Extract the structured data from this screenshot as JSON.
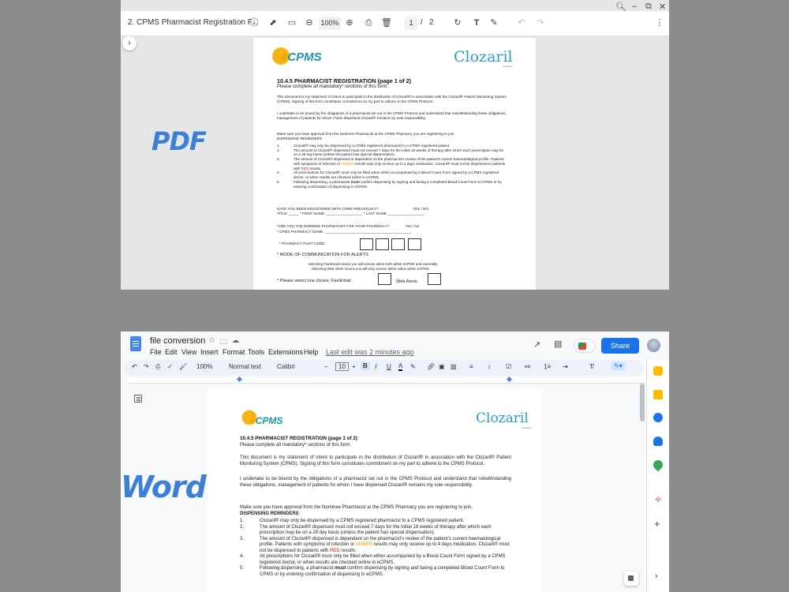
{
  "colors": {
    "accent": "#3d7fd7",
    "teal": "#1a9aa8",
    "amber": "#e8a000",
    "red": "#d01c1c",
    "docs_blue": "#1a73e8"
  },
  "badges": {
    "pdf": "PDF",
    "word": "Word"
  },
  "pdf_viewer": {
    "file_title": "2. CPMS Pharmacist Registration F...",
    "zoom": "100%",
    "page_current": "1",
    "page_total": "2",
    "icons": [
      "info-icon",
      "share-icon",
      "bookmark-icon",
      "zoom-out-icon",
      "zoom-in-icon",
      "print-icon",
      "delete-icon",
      "rotate-icon",
      "text-icon",
      "draw-icon",
      "undo-icon",
      "redo-icon",
      "more-icon",
      "window-zoom-icon",
      "minimize-icon",
      "restore-icon",
      "close-icon"
    ]
  },
  "document": {
    "logo_e": "e",
    "logo_cpms": "CPMS",
    "logo_clozaril": "Clozaril",
    "logo_clozaril_sub": "clozapine",
    "heading": "10.4.5 PHARMACIST REGISTRATION (page 1 of 2)",
    "subheading": "Please complete all mandatory* sections of this form.",
    "para1": "This document is my statement of intent to participate in the distribution of Clozaril® in association with the Clozaril® Patient Monitoring System (CPMS). Signing of this form constitutes commitment on my part to adhere to the CPMS Protocol.",
    "para2": "I undertake to be bound by the obligations of a pharmacist set out in the CPMS Protocol and understand that notwithstanding these obligations, management of patients for whom I have dispensed Clozaril® remains my sole responsibility.",
    "approval_note": "Make sure you have approval from the Nominee Pharmacist at the CPMS Pharmacy you are registering to join.",
    "reminders_title": "DISPENSING REMINDERS",
    "reminders": [
      {
        "num": "1.",
        "text": "Clozaril® may only be dispensed by a CPMS registered pharmacist to a CPMS registered patient."
      },
      {
        "num": "2.",
        "text": "The amount of Clozaril® dispensed must not exceed 7 days for the initial 18 weeks of therapy after which each prescription may be on a 28 day basis (unless the patient has special dispensation)."
      },
      {
        "num": "3.",
        "pre": "The amount of Clozaril® dispensed is dependent on the pharmacist's review of the patient's current haematological profile. Patients with symptoms of infection or ",
        "amber": "AMBER",
        "mid": " results may only receive up to 4 days medication. Clozaril® must not be dispensed to patients with ",
        "red": "RED",
        "post": " results."
      },
      {
        "num": "4.",
        "text": "All prescriptions for Clozaril® must only be filled when either accompanied by a Blood Count Form signed by a CPMS registered doctor, or when results are checked online in eCPMS."
      },
      {
        "num": "5.",
        "pre2": "Following dispensing, a pharmacist ",
        "bold": "must",
        "post2": " confirm dispensing by signing and faxing a completed Blood Count Form to CPMS or by entering confirmation of dispensing in eCPMS."
      }
    ],
    "q_registered": "HAVE YOU BEEN REGISTERED WITH CPMS PREVIOUSLY?",
    "q_registered_opts": "YES  /  NO",
    "name_line": "TITLE: _____ * FIRST NAME: __________________ * LAST NAME:__________________",
    "q_nominee": "*ARE YOU THE NOMINEE PHARMACIST FOR YOUR PHARMACY?",
    "q_nominee_opts": "Yes / No",
    "pharmacy_name": "* CPMS PHARMACY NAME: ___________________________________________",
    "postcode_label": "* PHARMACY POST CODE:",
    "comm_title": "* MODE OF COMMUNICATION FOR ALERTS",
    "comm_line1": "Selecting Fax/Email means you will receive alerts both within eCPMS and externally.",
    "comm_line2": "Selecting Web Alerts means you will only receive alerts online within eCPMS.",
    "choice_label": "* Please select one choice; Fax/Email",
    "web_alerts": "Web Alerts"
  },
  "docs": {
    "title": "file conversion",
    "menu": [
      "File",
      "Edit",
      "View",
      "Insert",
      "Format",
      "Tools",
      "Extensions",
      "Help"
    ],
    "last_edit": "Last edit was 2 minutes ago",
    "share": "Share",
    "zoom": "100%",
    "style": "Normal text",
    "font": "Calibri",
    "font_size": "10",
    "icons": [
      "docs-logo-icon",
      "star-icon",
      "folder-icon",
      "cloud-icon",
      "trending-icon",
      "comment-icon",
      "meet-icon",
      "avatar",
      "outline-icon",
      "undo-icon",
      "redo-icon",
      "print-icon",
      "spellcheck-icon",
      "paint-format-icon",
      "bold-icon",
      "italic-icon",
      "underline-icon",
      "text-color-icon",
      "highlight-icon",
      "link-icon",
      "insert-comment-icon",
      "image-icon",
      "align-icon",
      "line-spacing-icon",
      "checklist-icon",
      "bullet-list-icon",
      "numbered-list-icon",
      "indent-icon",
      "clear-format-icon",
      "pencil-icon",
      "calendar-icon",
      "keep-icon",
      "tasks-icon",
      "contacts-icon",
      "maps-icon",
      "plus-icon",
      "explore-icon"
    ]
  }
}
